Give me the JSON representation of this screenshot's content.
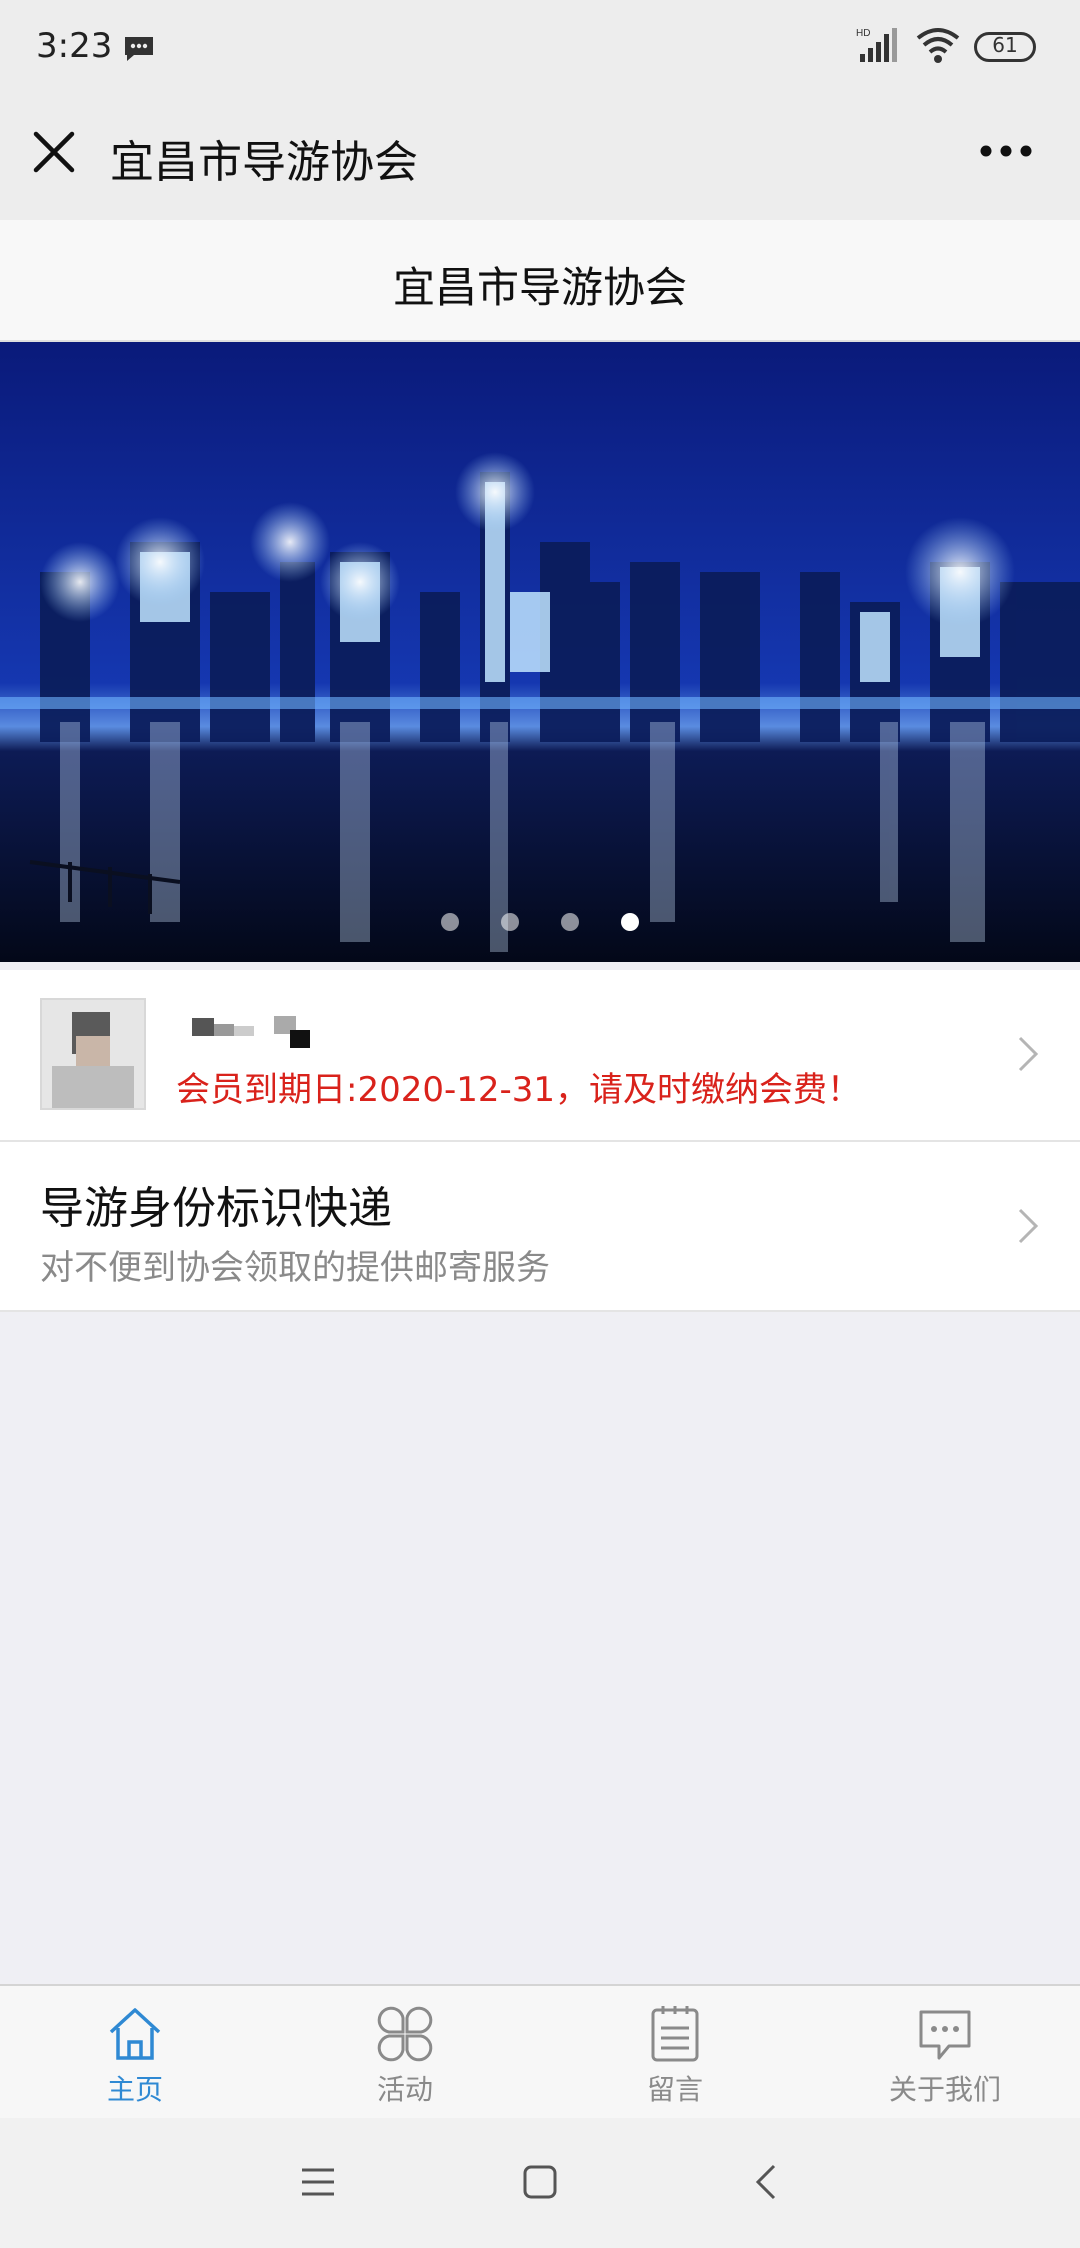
{
  "status_bar": {
    "time": "3:23",
    "battery": "61"
  },
  "title_bar": {
    "title": "宜昌市导游协会"
  },
  "page": {
    "header_title": "宜昌市导游协会"
  },
  "banner": {
    "total_slides": 4,
    "active_slide": 4
  },
  "member_card": {
    "notice": "会员到期日:2020-12-31，请及时缴纳会费！"
  },
  "express_card": {
    "title": "导游身份标识快递",
    "subtitle": "对不便到协会领取的提供邮寄服务"
  },
  "tab_bar": {
    "tabs": [
      {
        "label": "主页",
        "icon": "home-icon",
        "active": true
      },
      {
        "label": "活动",
        "icon": "clover-icon",
        "active": false
      },
      {
        "label": "留言",
        "icon": "notepad-icon",
        "active": false
      },
      {
        "label": "关于我们",
        "icon": "chat-bubble-icon",
        "active": false
      }
    ]
  },
  "colors": {
    "accent": "#2f89d3",
    "warning": "#d9221b",
    "background": "#efeff4"
  }
}
